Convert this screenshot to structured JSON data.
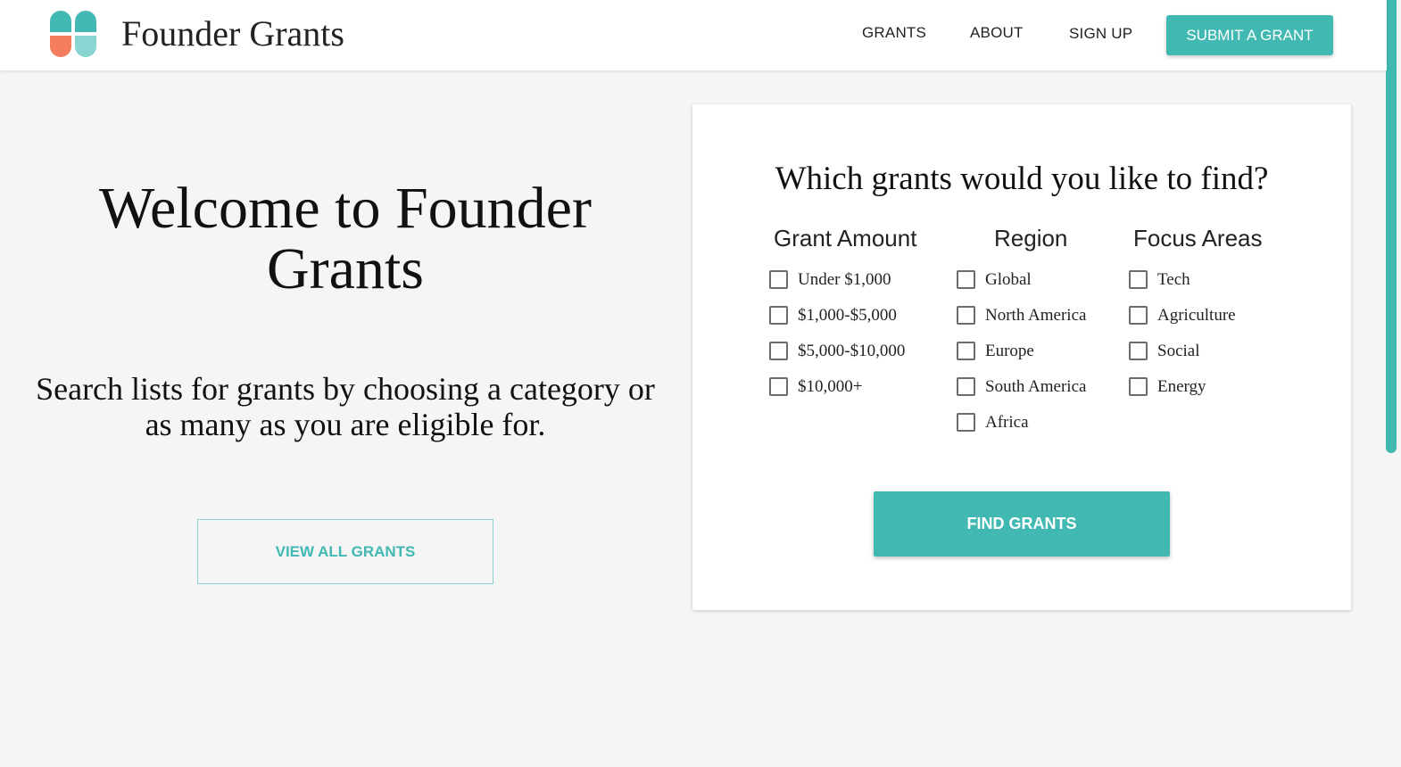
{
  "header": {
    "brand": "Founder Grants",
    "logo_icon": "clover-logo-icon",
    "nav": [
      {
        "label": "GRANTS"
      },
      {
        "label": "ABOUT"
      },
      {
        "label": "SIGN UP"
      }
    ],
    "cta_label": "SUBMIT A GRANT"
  },
  "hero": {
    "title": "Welcome to Founder Grants",
    "subtitle": "Search lists for grants by choosing a category or as many as you are eligible for.",
    "view_all_label": "VIEW ALL GRANTS"
  },
  "search_card": {
    "title": "Which grants would you like to find?",
    "columns": [
      {
        "heading": "Grant Amount",
        "options": [
          "Under $1,000",
          "$1,000-$5,000",
          "$5,000-$10,000",
          "$10,000+"
        ]
      },
      {
        "heading": "Region",
        "options": [
          "Global",
          "North America",
          "Europe",
          "South America",
          "Africa"
        ]
      },
      {
        "heading": "Focus Areas",
        "options": [
          "Tech",
          "Agriculture",
          "Social",
          "Energy"
        ]
      }
    ],
    "find_label": "FIND GRANTS"
  },
  "colors": {
    "accent": "#41b8b2",
    "logo_coral": "#f47c5f",
    "logo_light_teal": "#87d6d2",
    "background": "#f5f5f5"
  }
}
